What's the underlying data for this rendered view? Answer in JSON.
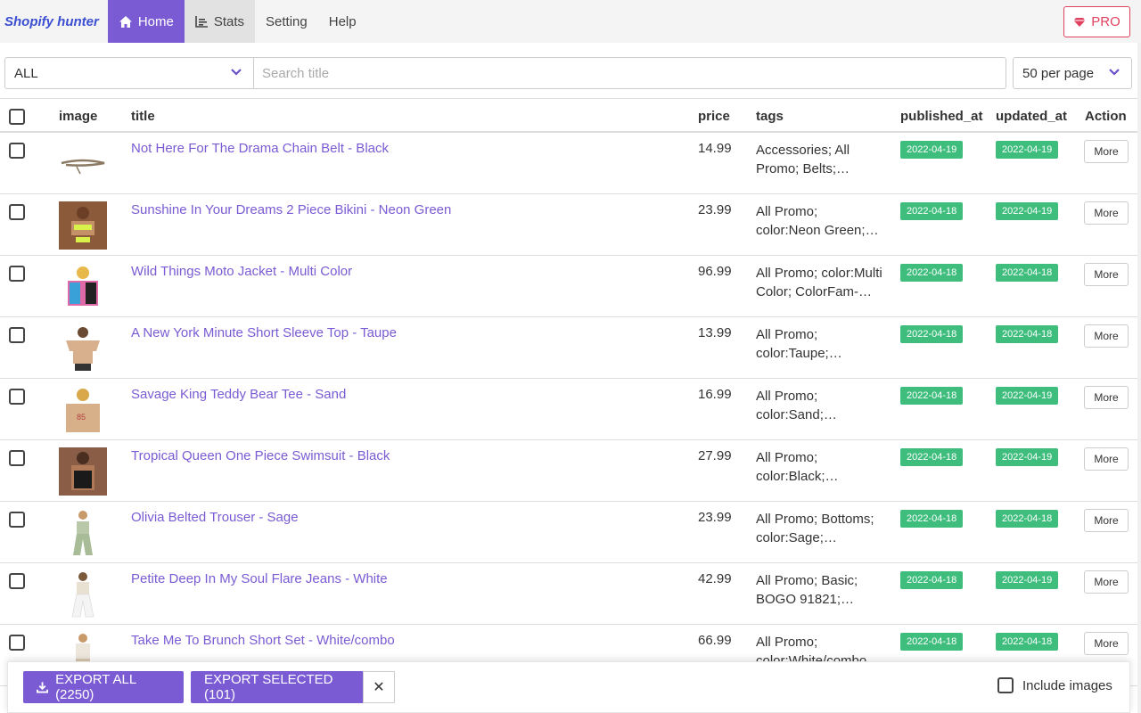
{
  "nav": {
    "brand": "Shopify hunter",
    "items": [
      {
        "label": "Home",
        "icon": "home-icon",
        "active": true
      },
      {
        "label": "Stats",
        "icon": "stats-icon"
      },
      {
        "label": "Setting"
      },
      {
        "label": "Help"
      }
    ],
    "pro_label": "PRO"
  },
  "filters": {
    "collection_value": "ALL",
    "search_placeholder": "Search title",
    "per_page_value": "50 per page"
  },
  "table": {
    "headers": [
      "image",
      "title",
      "price",
      "tags",
      "published_at",
      "updated_at",
      "Action"
    ],
    "rows": [
      {
        "title": "Not Here For The Drama Chain Belt - Black",
        "price": "14.99",
        "tags": "Accessories; All Promo; Belts;…",
        "published_at": "2022-04-19",
        "updated_at": "2022-04-19",
        "action": "More"
      },
      {
        "title": "Sunshine In Your Dreams 2 Piece Bikini - Neon Green",
        "price": "23.99",
        "tags": "All Promo; color:Neon Green;…",
        "published_at": "2022-04-18",
        "updated_at": "2022-04-19",
        "action": "More"
      },
      {
        "title": "Wild Things Moto Jacket - Multi Color",
        "price": "96.99",
        "tags": "All Promo; color:Multi Color; ColorFam-…",
        "published_at": "2022-04-18",
        "updated_at": "2022-04-18",
        "action": "More"
      },
      {
        "title": "A New York Minute Short Sleeve Top - Taupe",
        "price": "13.99",
        "tags": "All Promo; color:Taupe;…",
        "published_at": "2022-04-18",
        "updated_at": "2022-04-18",
        "action": "More"
      },
      {
        "title": "Savage King Teddy Bear Tee - Sand",
        "price": "16.99",
        "tags": "All Promo; color:Sand;…",
        "published_at": "2022-04-18",
        "updated_at": "2022-04-19",
        "action": "More"
      },
      {
        "title": "Tropical Queen One Piece Swimsuit - Black",
        "price": "27.99",
        "tags": "All Promo; color:Black;…",
        "published_at": "2022-04-18",
        "updated_at": "2022-04-19",
        "action": "More"
      },
      {
        "title": "Olivia Belted Trouser - Sage",
        "price": "23.99",
        "tags": "All Promo; Bottoms; color:Sage;…",
        "published_at": "2022-04-18",
        "updated_at": "2022-04-18",
        "action": "More"
      },
      {
        "title": "Petite Deep In My Soul Flare Jeans - White",
        "price": "42.99",
        "tags": "All Promo; Basic; BOGO 91821;…",
        "published_at": "2022-04-18",
        "updated_at": "2022-04-19",
        "action": "More"
      },
      {
        "title": "Take Me To Brunch Short Set - White/combo",
        "price": "66.99",
        "tags": "All Promo; color:White/combo",
        "published_at": "2022-04-18",
        "updated_at": "2022-04-18",
        "action": "More"
      }
    ]
  },
  "footer": {
    "export_all_label": "EXPORT ALL (2250)",
    "export_selected_label": "EXPORT SELECTED (101)",
    "close_label": "✕",
    "include_images_label": "Include images"
  },
  "colors": {
    "accent": "#7a5bd3",
    "badge": "#3ebd7d",
    "pro": "#e0415e",
    "brand": "#3b4fd1"
  }
}
